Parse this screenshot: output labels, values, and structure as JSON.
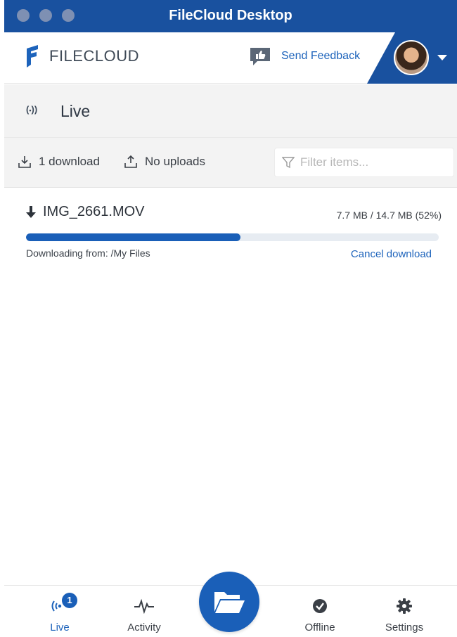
{
  "window": {
    "title": "FileCloud Desktop"
  },
  "header": {
    "brand": "FILECLOUD",
    "feedback_label": "Send Feedback"
  },
  "live": {
    "title": "Live",
    "icon": "live-signal-icon"
  },
  "toolbar": {
    "downloads_label": "1 download",
    "uploads_label": "No uploads",
    "filter_placeholder": "Filter items..."
  },
  "transfer": {
    "file_name": "IMG_2661.MOV",
    "size_text": "7.7 MB / 14.7 MB  (52%)",
    "progress_percent": 52,
    "source_text": "Downloading from:  /My Files",
    "cancel_label": "Cancel download"
  },
  "nav": {
    "items": [
      {
        "label": "Live",
        "badge": "1",
        "icon": "live-signal-icon",
        "active": true
      },
      {
        "label": "Activity",
        "icon": "activity-pulse-icon"
      },
      {
        "label": "Offline",
        "icon": "offline-check-icon"
      },
      {
        "label": "Settings",
        "icon": "gear-icon"
      }
    ],
    "center_icon": "folder-open-icon"
  },
  "colors": {
    "brand_blue": "#19519f",
    "accent_blue": "#1d63bb",
    "panel_gray": "#f3f3f3"
  }
}
